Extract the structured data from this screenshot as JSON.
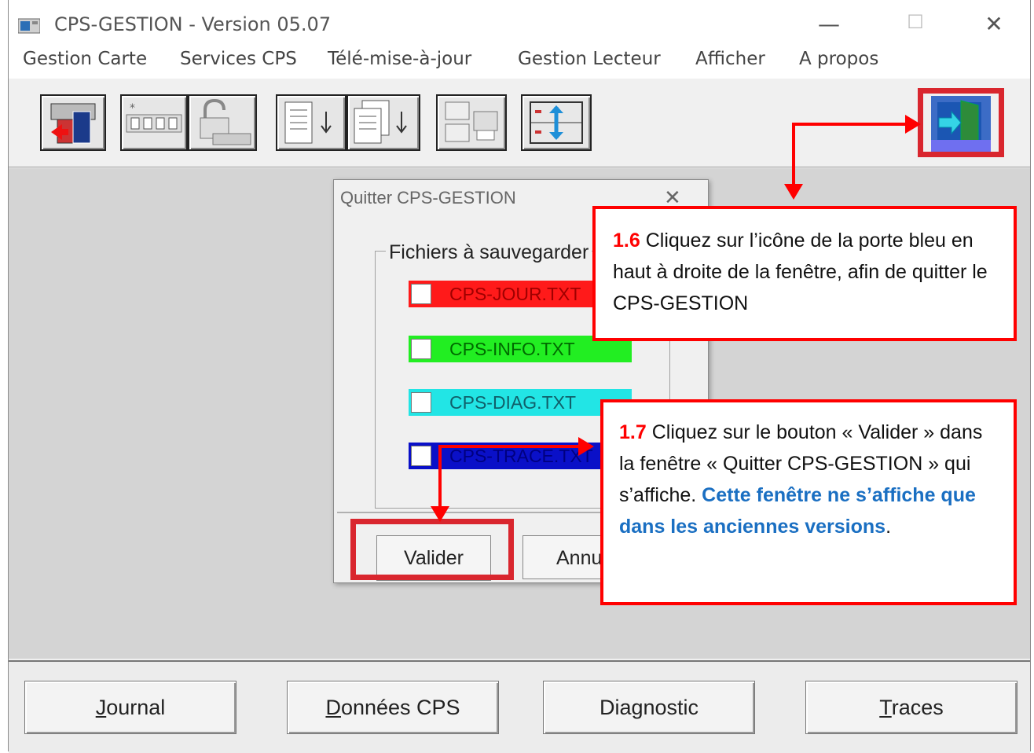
{
  "window": {
    "title": "CPS-GESTION - Version 05.07",
    "min_glyph": "—",
    "max_glyph": "☐",
    "close_glyph": "✕"
  },
  "menu": [
    "Gestion Carte",
    "Services CPS",
    "Télé-mise-à-jour",
    "Gestion Lecteur",
    "Afficher",
    "A propos"
  ],
  "toolbar": {
    "icons": [
      "card-reader-icon",
      "card-slots-icon",
      "unlock-keyboard-icon",
      "document-down-icon",
      "documents-down-icon",
      "computer-printer-icon",
      "update-transfer-icon",
      "exit-door-icon"
    ]
  },
  "dialog": {
    "title": "Quitter CPS-GESTION",
    "close_glyph": "✕",
    "group_label": "Fichiers à sauvegarder",
    "files": [
      {
        "label": "CPS-JOUR.TXT",
        "bg": "#ff1a1a",
        "fg": "#a00000",
        "checked": false
      },
      {
        "label": "CPS-INFO.TXT",
        "bg": "#22ee22",
        "fg": "#006a00",
        "checked": false
      },
      {
        "label": "CPS-DIAG.TXT",
        "bg": "#22e5e5",
        "fg": "#10606a",
        "checked": false
      },
      {
        "label": "CPS-TRACE.TXT",
        "bg": "#0a10c8",
        "fg": "#000080",
        "checked": false
      }
    ],
    "validate_label": "Valider",
    "cancel_label": "Annuler"
  },
  "bottom": {
    "journal": {
      "first": "J",
      "rest": "ournal"
    },
    "donnees": {
      "first": "D",
      "rest": "onnées CPS"
    },
    "diagnostic": {
      "pre": "Dia",
      "mid": "g",
      "post": "nostic"
    },
    "traces": {
      "first": "T",
      "rest": "races"
    }
  },
  "callouts": {
    "c16": {
      "number": "1.6",
      "text": " Cliquez sur l’icône de la porte bleu en haut à droite de la fenêtre, afin de quitter le CPS-GESTION"
    },
    "c17": {
      "number": "1.7",
      "text": " Cliquez sur le bouton « Valider » dans la fenêtre « Quitter CPS-GESTION » qui s’affiche. ",
      "highlight": "Cette fenêtre ne s’affiche que dans les anciennes versions",
      "tail": "."
    }
  },
  "colors": {
    "annotation_red": "#ff0000",
    "frame_red": "#d9262e",
    "highlight_blue": "#1a6fc2"
  }
}
